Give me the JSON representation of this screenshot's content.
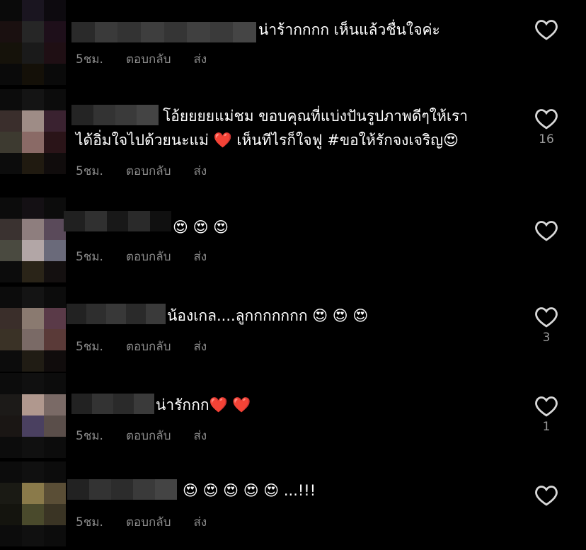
{
  "comments": [
    {
      "text": "น่าร้ากกกก เห็นแล้วชื่นใจค่ะ",
      "time": "5ชม.",
      "reply": "ตอบกลับ",
      "send": "ส่ง",
      "likes": ""
    },
    {
      "text_line1": "โอ้ยยยยแม่ชม ขอบคุณที่แบ่งปันรูปภาพดีๆให้เรา",
      "text_line2": "ได้อิ่มใจไปด้วยนะแม่ ❤️  เห็นทีไรก็ใจฟู  #ขอให้รักจงเจริญ😍",
      "time": "5ชม.",
      "reply": "ตอบกลับ",
      "send": "ส่ง",
      "likes": "16"
    },
    {
      "text": "😍 😍 😍",
      "time": "5ชม.",
      "reply": "ตอบกลับ",
      "send": "ส่ง",
      "likes": ""
    },
    {
      "text": "น้องเกล....ลูกกกกกกก 😍 😍 😍",
      "time": "5ชม.",
      "reply": "ตอบกลับ",
      "send": "ส่ง",
      "likes": "3"
    },
    {
      "text": "น่ารักกก❤️ ❤️",
      "time": "5ชม.",
      "reply": "ตอบกลับ",
      "send": "ส่ง",
      "likes": "1"
    },
    {
      "text": "😍 😍 😍 😍 😍 ...!!!",
      "time": "5ชม.",
      "reply": "ตอบกลับ",
      "send": "ส่ง",
      "likes": ""
    }
  ],
  "icons": {
    "like": "heart-outline-icon",
    "avatar": "blurred-avatar"
  },
  "colors": {
    "background": "#000000",
    "text": "#ffffff",
    "meta": "#8a8a8a"
  }
}
